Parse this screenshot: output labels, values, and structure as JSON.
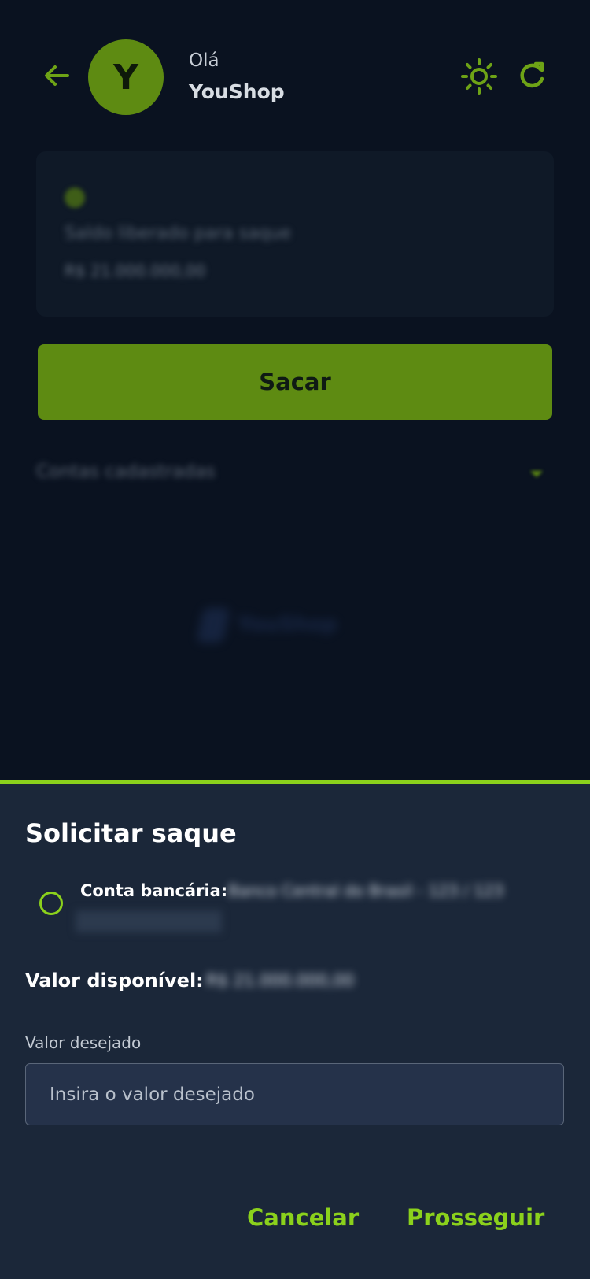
{
  "header": {
    "avatar_initial": "Y",
    "greeting": "Olá",
    "shop_name": "YouShop",
    "icons": [
      "back-arrow-icon",
      "sun-icon",
      "refresh-icon"
    ]
  },
  "balance_card": {
    "label": "Saldo liberado para saque",
    "value": "R$ 21.000.000,00"
  },
  "actions": {
    "withdraw_label": "Sacar"
  },
  "accounts": {
    "label": "Contas cadastradas"
  },
  "footer": {
    "brand": "YouShop"
  },
  "withdraw_sheet": {
    "title": "Solicitar saque",
    "account_label": "Conta bancária:",
    "account_value": "Banco Central do Brasil - 123 / 123",
    "available_label": "Valor disponível:",
    "available_value": "R$ 21.000.000,00",
    "desired_label": "Valor desejado",
    "desired_placeholder": "Insira o valor desejado",
    "cancel_label": "Cancelar",
    "proceed_label": "Prosseguir"
  },
  "colors": {
    "background": "#0a1220",
    "accent": "#8bd11c",
    "primary_button": "#5e8b12",
    "sheet": "#1b2739"
  }
}
